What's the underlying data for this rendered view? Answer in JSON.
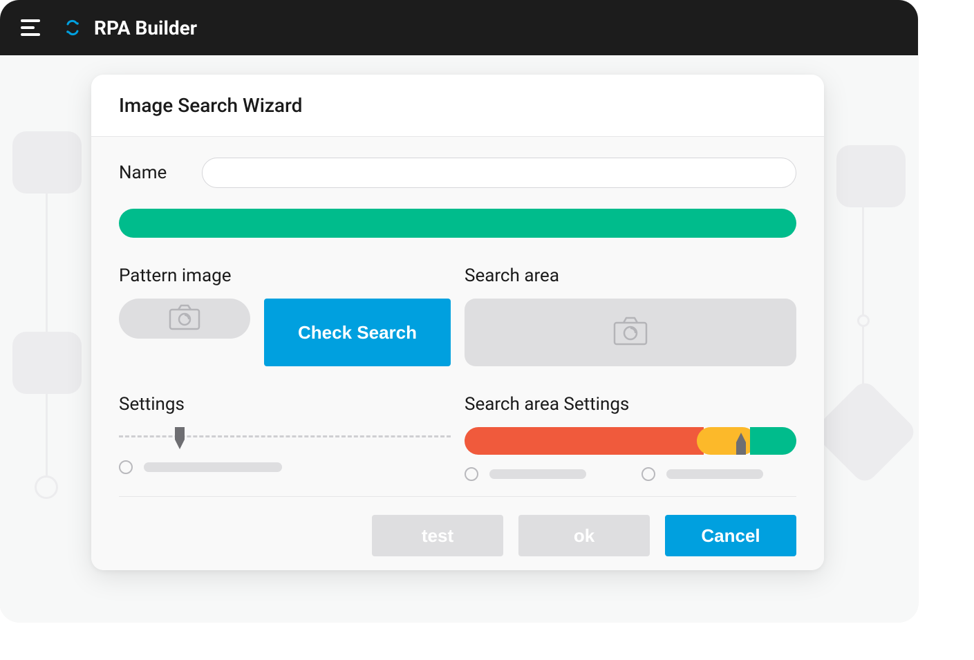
{
  "app": {
    "title": "RPA Builder"
  },
  "dialog": {
    "title": "Image Search Wizard",
    "name_label": "Name",
    "name_value": "",
    "pattern_image_label": "Pattern image",
    "check_search_label": "Check Search",
    "search_area_label": "Search area",
    "settings_label": "Settings",
    "search_area_settings_label": "Search area Settings",
    "buttons": {
      "test": "test",
      "ok": "ok",
      "cancel": "Cancel"
    },
    "colors": {
      "progress": "#00bc8c",
      "primary": "#00a0df",
      "seg_red": "#f05a3c",
      "seg_yellow": "#fcb92a",
      "seg_green": "#00bc8c"
    },
    "settings_slider_pos_pct": 18,
    "search_area_slider_pos_pct": 82
  }
}
